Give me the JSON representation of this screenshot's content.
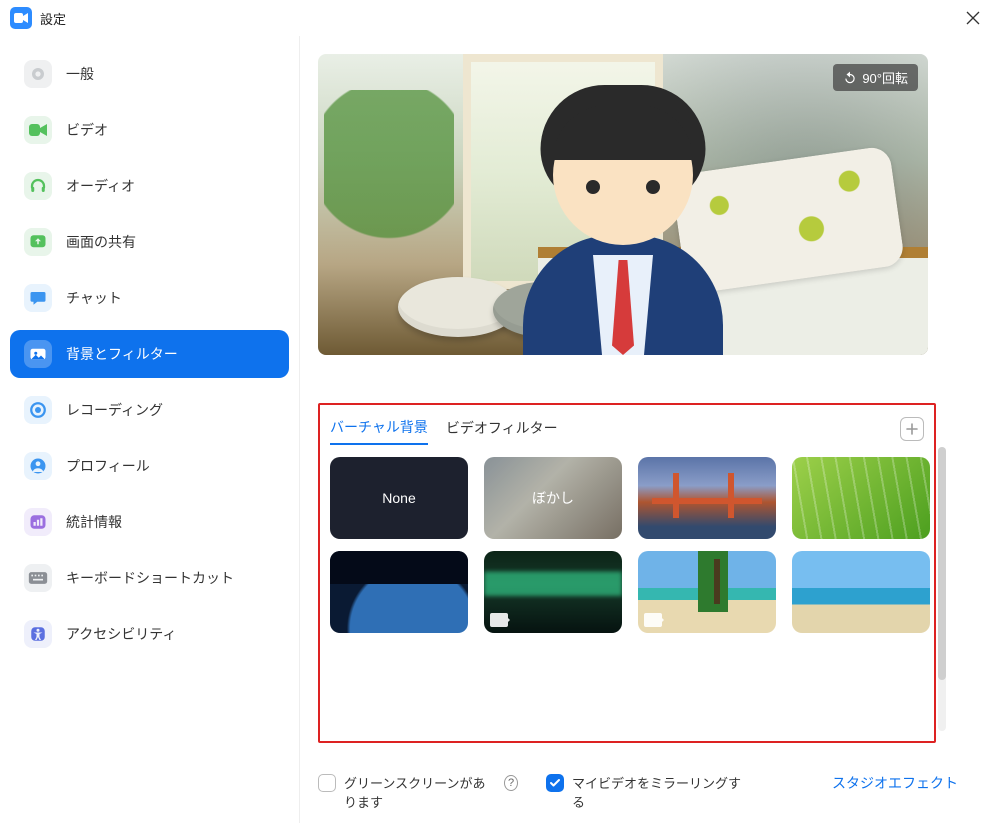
{
  "titlebar": {
    "title": "設定"
  },
  "sidebar": {
    "items": [
      {
        "label": "一般",
        "icon": "gear",
        "bg": "#eff0f1",
        "fg": "#c9cccf"
      },
      {
        "label": "ビデオ",
        "icon": "video",
        "bg": "#e8f5ea",
        "fg": "#54c15d"
      },
      {
        "label": "オーディオ",
        "icon": "headset",
        "bg": "#e8f5ea",
        "fg": "#54c15d"
      },
      {
        "label": "画面の共有",
        "icon": "share",
        "bg": "#e8f5ea",
        "fg": "#54c15d"
      },
      {
        "label": "チャット",
        "icon": "chat",
        "bg": "#e8f3fd",
        "fg": "#3b95f0"
      },
      {
        "label": "背景とフィルター",
        "icon": "bgfilter",
        "bg": "#ffffff",
        "fg": "#ffffff"
      },
      {
        "label": "レコーディング",
        "icon": "record",
        "bg": "#e8f3fd",
        "fg": "#3b95f0"
      },
      {
        "label": "プロフィール",
        "icon": "profile",
        "bg": "#e8f3fd",
        "fg": "#3b95f0"
      },
      {
        "label": "統計情報",
        "icon": "stats",
        "bg": "#f1ecfb",
        "fg": "#9b6fe0"
      },
      {
        "label": "キーボードショートカット",
        "icon": "keyboard",
        "bg": "#eef0f2",
        "fg": "#8b8f95"
      },
      {
        "label": "アクセシビリティ",
        "icon": "accessibility",
        "bg": "#eef0fb",
        "fg": "#5b6fe0"
      }
    ]
  },
  "preview": {
    "rotate_label": "90°回転"
  },
  "tabs": {
    "virtual_bg": "バーチャル背景",
    "video_filter": "ビデオフィルター"
  },
  "thumbs": {
    "none": "None",
    "blur": "ぼかし"
  },
  "footer": {
    "green_screen": "グリーンスクリーンがあります",
    "mirror_video": "マイビデオをミラーリングする",
    "studio_effects": "スタジオエフェクト"
  }
}
